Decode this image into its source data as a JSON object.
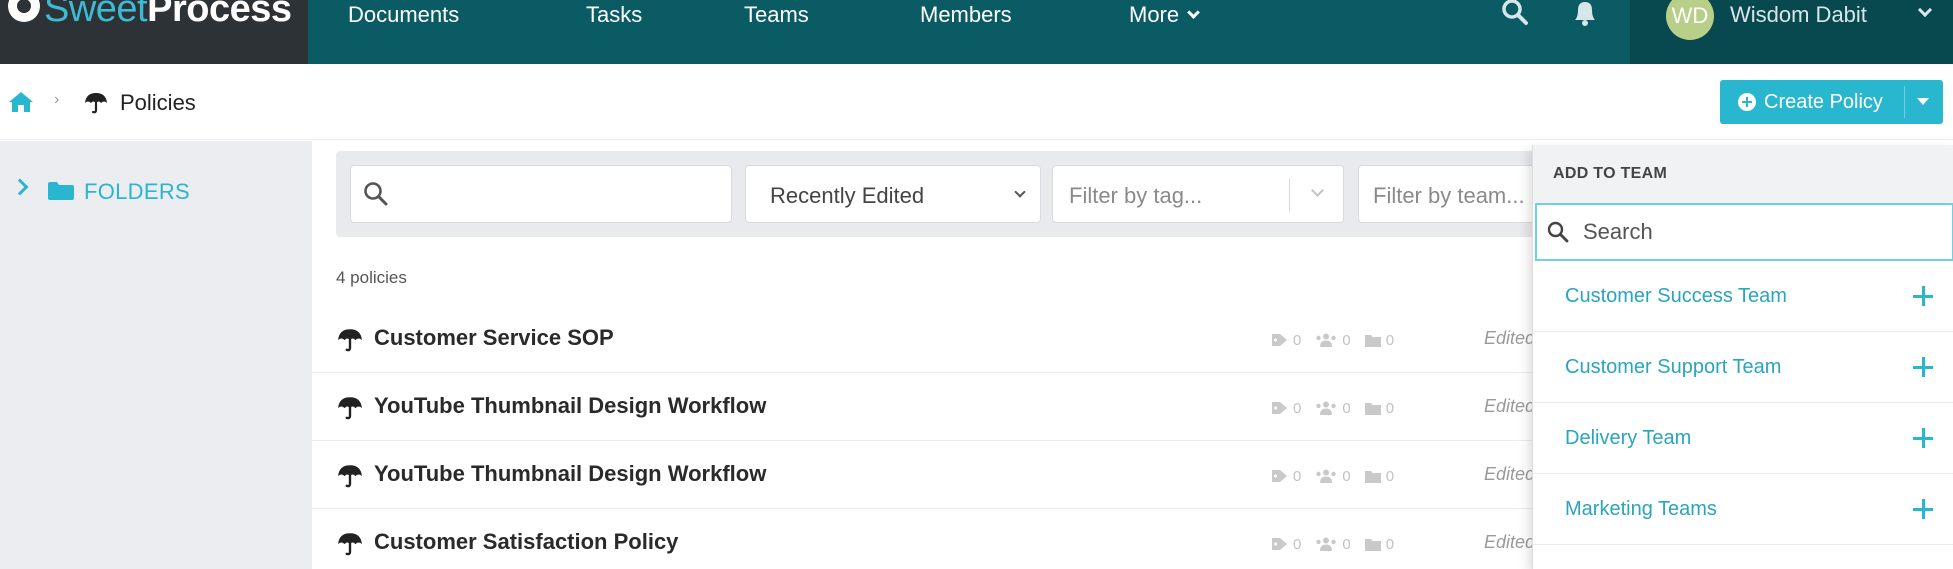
{
  "brand": {
    "name_light": "Sweet",
    "name_bold": "Process"
  },
  "nav": {
    "links": [
      "Documents",
      "Tasks",
      "Teams",
      "Members"
    ],
    "more_label": "More",
    "icons": [
      "search-icon",
      "bell-icon"
    ]
  },
  "user": {
    "initials": "WD",
    "name": "Wisdom Dabit",
    "avatar_color": "#b8cf8a"
  },
  "breadcrumb": {
    "current": "Policies"
  },
  "toolbar": {
    "create_label": "Create Policy"
  },
  "sidebar": {
    "folders_label": "FOLDERS"
  },
  "filters": {
    "search_value": "",
    "sort_value": "Recently Edited",
    "tag_placeholder": "Filter by tag...",
    "team_placeholder": "Filter by team..."
  },
  "list": {
    "count_label": "4 policies",
    "items": [
      {
        "title": "Customer Service SOP",
        "tags": "0",
        "teams": "0",
        "folders": "0",
        "edited": "Edited"
      },
      {
        "title": "YouTube Thumbnail Design Workflow",
        "tags": "0",
        "teams": "0",
        "folders": "0",
        "edited": "Edited"
      },
      {
        "title": "YouTube Thumbnail Design Workflow",
        "tags": "0",
        "teams": "0",
        "folders": "0",
        "edited": "Edited"
      },
      {
        "title": "Customer Satisfaction Policy",
        "tags": "0",
        "teams": "0",
        "folders": "0",
        "edited": "Edited"
      }
    ]
  },
  "team_panel": {
    "header": "ADD TO TEAM",
    "search_placeholder": "Search",
    "teams": [
      "Customer Success Team",
      "Customer Support Team",
      "Delivery Team",
      "Marketing Teams"
    ]
  },
  "colors": {
    "nav_bg": "#0a5b64",
    "accent": "#29b6cf",
    "brand_bg": "#2d3237"
  }
}
